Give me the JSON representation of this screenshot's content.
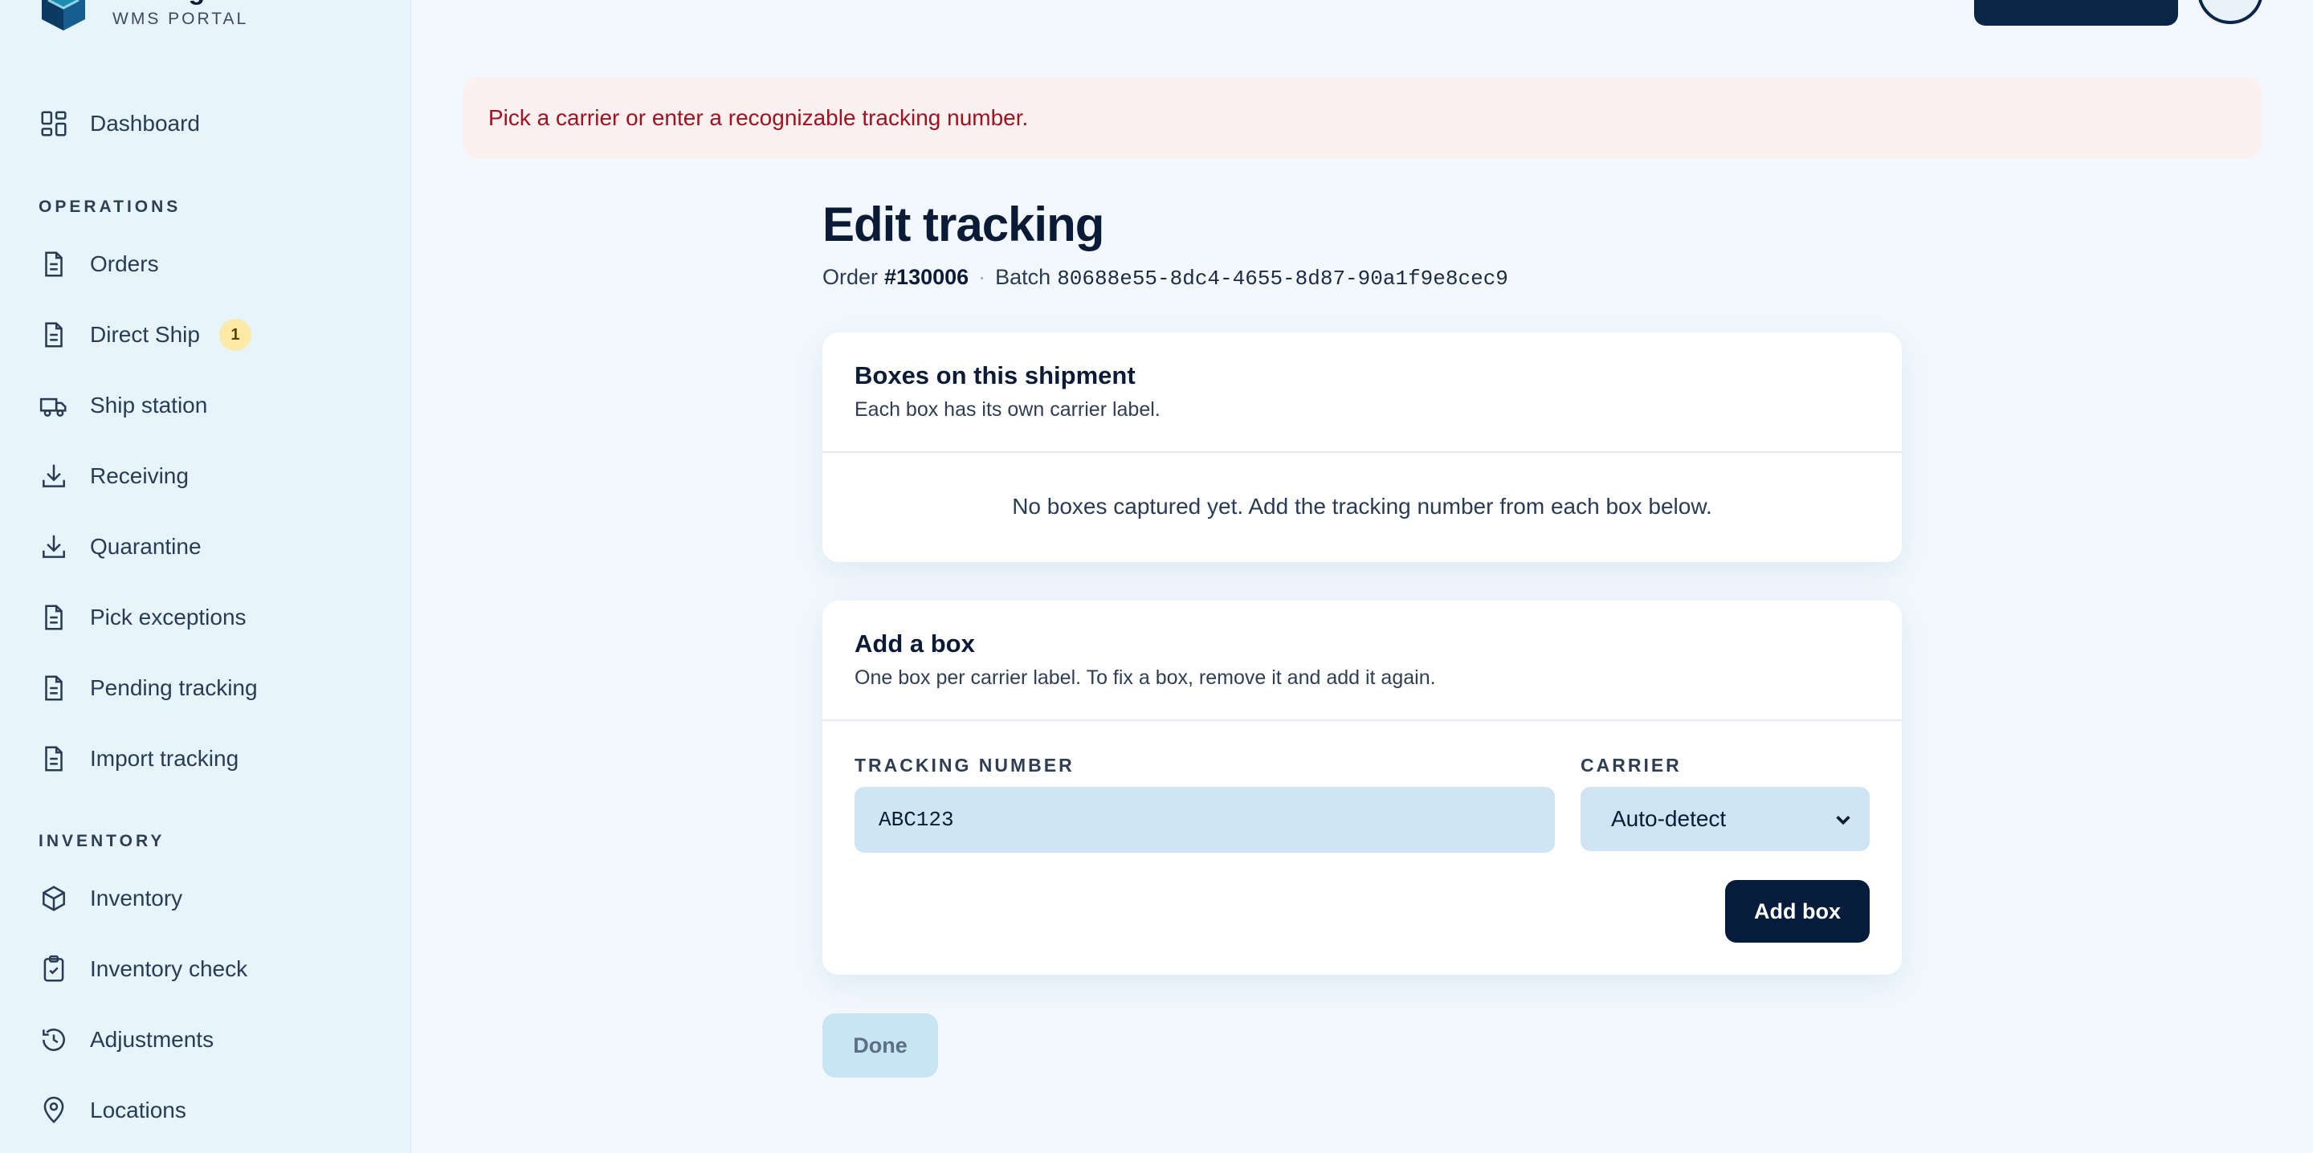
{
  "brand": {
    "name": "ConsignTrak",
    "subtitle": "WMS PORTAL"
  },
  "sidebar": {
    "dashboard": "Dashboard",
    "operations_label": "OPERATIONS",
    "operations": [
      {
        "label": "Orders",
        "icon": "document-icon"
      },
      {
        "label": "Direct Ship",
        "icon": "document-icon",
        "badge": "1"
      },
      {
        "label": "Ship station",
        "icon": "truck-icon"
      },
      {
        "label": "Receiving",
        "icon": "download-icon"
      },
      {
        "label": "Quarantine",
        "icon": "download-icon"
      },
      {
        "label": "Pick exceptions",
        "icon": "document-icon"
      },
      {
        "label": "Pending tracking",
        "icon": "document-icon"
      },
      {
        "label": "Import tracking",
        "icon": "document-icon"
      }
    ],
    "inventory_label": "INVENTORY",
    "inventory": [
      {
        "label": "Inventory",
        "icon": "box-icon"
      },
      {
        "label": "Inventory check",
        "icon": "clipboard-check-icon"
      },
      {
        "label": "Adjustments",
        "icon": "history-icon"
      },
      {
        "label": "Locations",
        "icon": "map-pin-icon"
      }
    ]
  },
  "alert": {
    "message": "Pick a carrier or enter a recognizable tracking number."
  },
  "page": {
    "title": "Edit tracking",
    "order_label": "Order",
    "order_number": "#130006",
    "separator": "·",
    "batch_label": "Batch",
    "batch_id": "80688e55-8dc4-4655-8d87-90a1f9e8cec9"
  },
  "boxes_card": {
    "title": "Boxes on this shipment",
    "description": "Each box has its own carrier label.",
    "empty_message": "No boxes captured yet. Add the tracking number from each box below."
  },
  "add_card": {
    "title": "Add a box",
    "description": "One box per carrier label. To fix a box, remove it and add it again.",
    "tracking_label": "TRACKING NUMBER",
    "tracking_value": "ABC123",
    "carrier_label": "CARRIER",
    "carrier_value": "Auto-detect",
    "add_button": "Add box"
  },
  "done_button": "Done",
  "colors": {
    "primary": "#061c3d",
    "alert_text": "#a1121e",
    "alert_bg": "#fdf0f1",
    "badge_bg": "#fde9a8"
  }
}
